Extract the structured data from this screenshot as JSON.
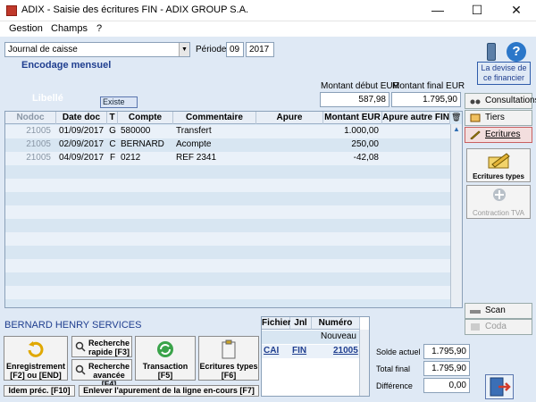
{
  "window": {
    "title": "ADIX - Saisie des écritures FIN - ADIX GROUP S.A.",
    "minimize": "—",
    "maximize": "☐",
    "close": "✕"
  },
  "menu": [
    {
      "label": "Gestion"
    },
    {
      "label": "Champs"
    },
    {
      "label": "?"
    }
  ],
  "header": {
    "journal": "Journal de caisse",
    "periode_label": "Période",
    "periode_month": "09",
    "periode_year": "2017",
    "encodage": "Encodage mensuel",
    "libelle": "Libellé",
    "existe": "Existe",
    "montant_debut_label": "Montant début EUR",
    "montant_final_label": "Montant final EUR",
    "montant_debut": "587,98",
    "montant_final": "1.795,90",
    "devise_button": "La devise de ce financier"
  },
  "grid": {
    "columns": [
      "Nodoc",
      "Date doc",
      "T",
      "Compte",
      "Commentaire",
      "Apure",
      "Montant EUR",
      "Apure autre FIN"
    ],
    "rows": [
      {
        "nodoc": "21005",
        "date": "01/09/2017",
        "t": "G",
        "compte": "580000",
        "commentaire": "Transfert",
        "apure": "",
        "montant": "1.000,00",
        "autre": ""
      },
      {
        "nodoc": "21005",
        "date": "02/09/2017",
        "t": "C",
        "compte": "BERNARD",
        "commentaire": "Acompte",
        "apure": "",
        "montant": "250,00",
        "autre": ""
      },
      {
        "nodoc": "21005",
        "date": "04/09/2017",
        "t": "F",
        "compte": "0212",
        "commentaire": "REF 2341",
        "apure": "",
        "montant": "-42,08",
        "autre": ""
      }
    ]
  },
  "right_panel": {
    "consultations": "Consultations",
    "tiers": "Tiers",
    "ecritures": "Ecritures",
    "ecritures_types": "Ecritures types",
    "contraction_tva": "Contraction TVA",
    "scan": "Scan",
    "coda": "Coda"
  },
  "bottom": {
    "company": "BERNARD HENRY SERVICES",
    "enregistrement": "Enregistrement [F2] ou [END]",
    "recherche_rapide": "Recherche rapide [F3]",
    "recherche_avancee": "Recherche avancée [F4]",
    "transaction": "Transaction [F5]",
    "ecritures_types": "Ecritures types [F6]",
    "idem_prec": "Idem préc. [F10]",
    "enlever": "Enlever l'apurement de la ligne en-cours [F7]"
  },
  "fichier": {
    "headers": [
      "Fichier",
      "Jnl",
      "Numéro"
    ],
    "nouveau": "Nouveau",
    "row": {
      "fichier": "CAI",
      "jnl": "FIN",
      "numero": "21005"
    }
  },
  "totals": {
    "solde_label": "Solde actuel",
    "solde": "1.795,90",
    "total_label": "Total final",
    "total": "1.795,90",
    "difference_label": "Différence",
    "difference": "0,00"
  }
}
